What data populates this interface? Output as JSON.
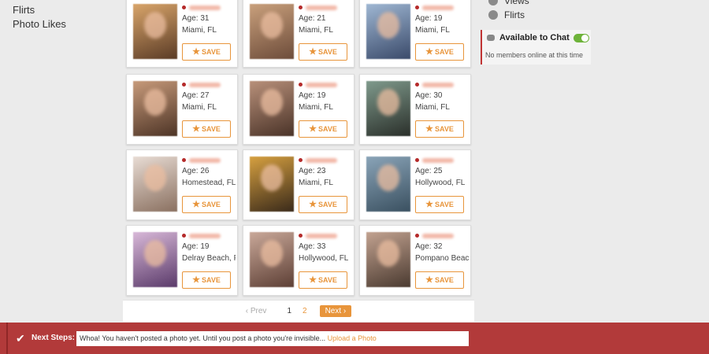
{
  "left_nav": {
    "items": [
      "Flirts",
      "Photo Likes"
    ]
  },
  "right_panel": {
    "items": [
      {
        "label": "Views",
        "icon": "eye-icon"
      },
      {
        "label": "Flirts",
        "icon": "smiley-icon"
      }
    ],
    "chat": {
      "title": "Available to Chat",
      "status": "No members online at this time"
    }
  },
  "save_label": "SAVE",
  "cards": [
    {
      "age": "Age: 31",
      "location": "Miami, FL"
    },
    {
      "age": "Age: 21",
      "location": "Miami, FL"
    },
    {
      "age": "Age: 19",
      "location": "Miami, FL"
    },
    {
      "age": "Age: 27",
      "location": "Miami, FL"
    },
    {
      "age": "Age: 19",
      "location": "Miami, FL"
    },
    {
      "age": "Age: 30",
      "location": "Miami, FL"
    },
    {
      "age": "Age: 26",
      "location": "Homestead, FL"
    },
    {
      "age": "Age: 23",
      "location": "Miami, FL"
    },
    {
      "age": "Age: 25",
      "location": "Hollywood, FL"
    },
    {
      "age": "Age: 19",
      "location": "Delray Beach, F"
    },
    {
      "age": "Age: 33",
      "location": "Hollywood, FL"
    },
    {
      "age": "Age: 32",
      "location": "Pompano Beach"
    }
  ],
  "pagination": {
    "prev": "Prev",
    "pages": [
      "1",
      "2"
    ],
    "next": "Next"
  },
  "footer": {
    "label": "Next Steps:",
    "message": "Whoa! You haven't posted a photo yet. Until you post a photo you're invisible...",
    "link": "Upload a Photo"
  },
  "colors": {
    "accent": "#e8953b",
    "footer": "#b23a3a",
    "online_dot": "#b52a2a",
    "toggle": "#6eb33a"
  }
}
